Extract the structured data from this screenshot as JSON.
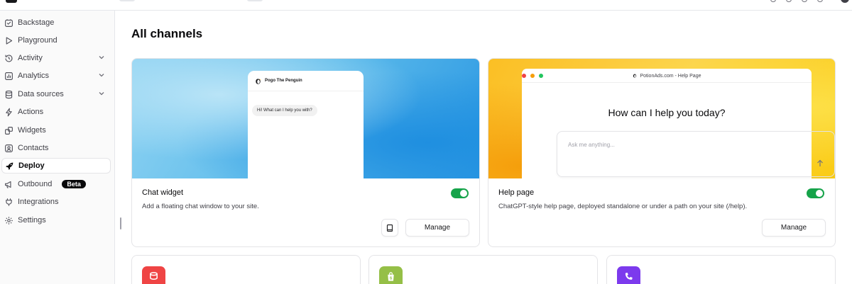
{
  "sidebar": {
    "items": [
      {
        "label": "Backstage",
        "icon": "backstage-icon"
      },
      {
        "label": "Playground",
        "icon": "play-icon"
      },
      {
        "label": "Activity",
        "icon": "history-icon",
        "expandable": true
      },
      {
        "label": "Analytics",
        "icon": "chart-icon",
        "expandable": true
      },
      {
        "label": "Data sources",
        "icon": "database-icon",
        "expandable": true
      },
      {
        "label": "Actions",
        "icon": "bolt-icon"
      },
      {
        "label": "Widgets",
        "icon": "puzzle-icon"
      },
      {
        "label": "Contacts",
        "icon": "contact-icon"
      },
      {
        "label": "Deploy",
        "icon": "rocket-icon",
        "active": true
      },
      {
        "label": "Outbound",
        "icon": "megaphone-icon",
        "badge": "Beta"
      },
      {
        "label": "Integrations",
        "icon": "plug-icon"
      },
      {
        "label": "Settings",
        "icon": "gear-icon"
      }
    ]
  },
  "main": {
    "title": "All channels",
    "channels": [
      {
        "name": "Chat widget",
        "description": "Add a floating chat window to your site.",
        "enabled": true,
        "manage_label": "Manage",
        "preview": {
          "bot_name": "Pogo The Penguin",
          "greeting": "Hi! What can I help you with?"
        }
      },
      {
        "name": "Help page",
        "description": "ChatGPT-style help page, deployed standalone or under a path on your site (/help).",
        "enabled": true,
        "manage_label": "Manage",
        "preview": {
          "browser_title": "PotionAds.com - Help Page",
          "heading": "How can I help you today?",
          "placeholder": "Ask me anything..."
        }
      }
    ],
    "more_channels": [
      {
        "icon": "database-icon",
        "color": "#ef4444"
      },
      {
        "icon": "shopify-icon",
        "color": "#95bf47"
      },
      {
        "icon": "phone-icon",
        "color": "#7c3aed"
      }
    ]
  },
  "colors": {
    "toggle_on": "#16a34a",
    "accent_dark": "#09090b"
  }
}
